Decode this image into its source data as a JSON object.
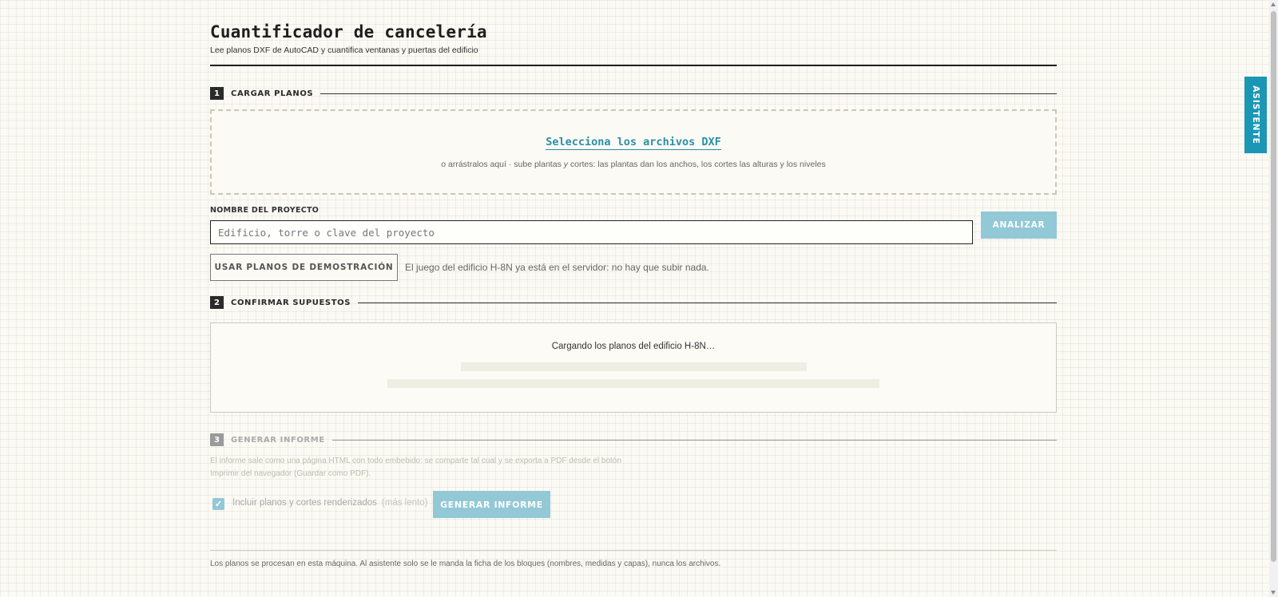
{
  "header": {
    "title": "Cuantificador de cancelería",
    "subtitle": "Lee planos DXF de AutoCAD y cuantifica ventanas y puertas del edificio"
  },
  "section1": {
    "number": "1",
    "label": "CARGAR PLANOS",
    "dropzone": {
      "link": "Selecciona los archivos DXF",
      "hint_pre": "o arrástralos aquí · sube plantas ",
      "hint_y": "y",
      "hint_post": " cortes: las plantas dan los anchos, los cortes las alturas y los niveles"
    },
    "project_label": "NOMBRE DEL PROYECTO",
    "project_placeholder": "Edificio, torre o clave del proyecto",
    "project_value": "",
    "analyze_button": "ANALIZAR",
    "demo_button": "USAR PLANOS DE DEMOSTRACIÓN",
    "demo_note": "El juego del edificio H-8N ya está en el servidor: no hay que subir nada."
  },
  "section2": {
    "number": "2",
    "label": "CONFIRMAR SUPUESTOS",
    "loading_text": "Cargando los planos del edificio H-8N…"
  },
  "section3": {
    "number": "3",
    "label": "GENERAR INFORME",
    "description": "El informe sale como una página HTML con todo embebido: se comparte tal cual y se exporta a PDF desde el botón Imprimir del navegador (Guardar como PDF).",
    "checkbox_label": "Incluir planos y cortes renderizados",
    "checkbox_note": "(más lento)",
    "checkbox_checked": true,
    "generate_button": "GENERAR INFORME"
  },
  "footer": {
    "note": "Los planos se procesan en esta máquina. Al asistente solo se le manda la ficha de los bloques (nombres, medidas y capas), nunca los archivos."
  },
  "side_tab": {
    "label": "ASISTENTE"
  },
  "colors": {
    "accent": "#1b97b5",
    "accent_disabled": "#93c8d6",
    "link": "#2a8fa8",
    "text": "#222222"
  }
}
